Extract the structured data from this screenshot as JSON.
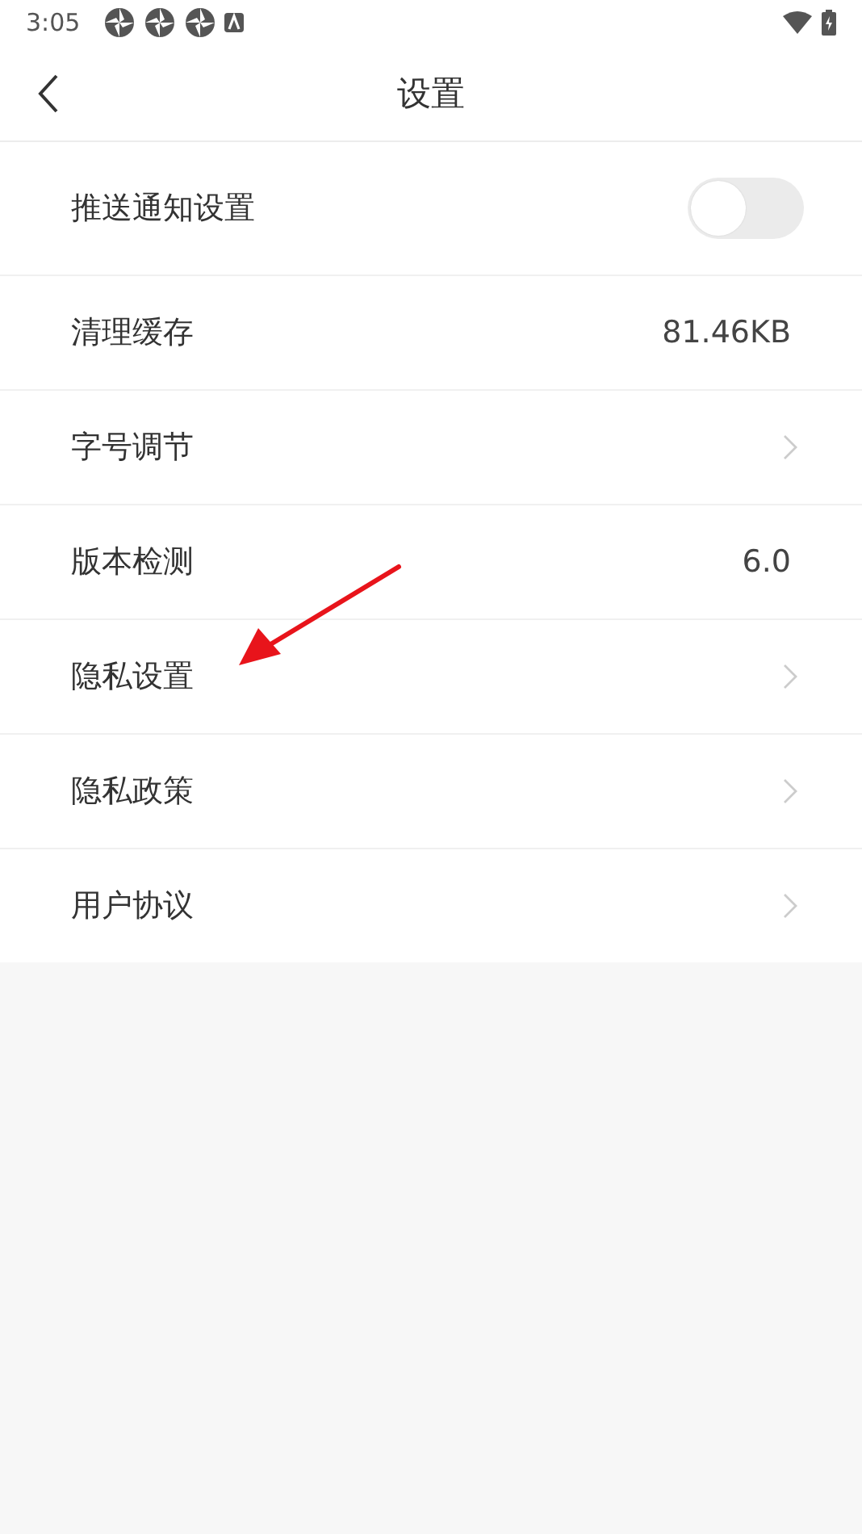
{
  "status_bar": {
    "time": "3:05"
  },
  "header": {
    "title": "设置"
  },
  "settings": [
    {
      "kind": "toggle",
      "label": "推送通知设置",
      "on": false
    },
    {
      "kind": "value",
      "label": "清理缓存",
      "value": "81.46KB"
    },
    {
      "kind": "link",
      "label": "字号调节"
    },
    {
      "kind": "value",
      "label": "版本检测",
      "value": "6.0"
    },
    {
      "kind": "link",
      "label": "隐私设置"
    },
    {
      "kind": "link",
      "label": "隐私政策"
    },
    {
      "kind": "link",
      "label": "用户协议"
    }
  ]
}
